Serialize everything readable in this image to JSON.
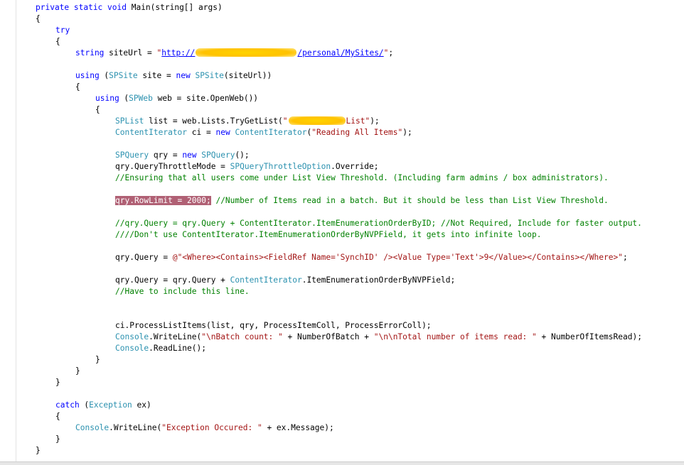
{
  "code": {
    "l1": {
      "kw1": "private static void ",
      "rest": "Main(string[] args)"
    },
    "l2": "{",
    "l3": "try",
    "l4": "{",
    "l5": {
      "kw": "string",
      "a": " siteUrl = ",
      "q": "\"",
      "url_start": "http://",
      "url_end": "/personal/MySites/",
      "end_q": "\"",
      "end": ";"
    },
    "l6": {
      "kw": "using",
      "a": " (",
      "typ": "SPSite",
      "b": " site = ",
      "kw2": "new",
      "c": " ",
      "typ2": "SPSite",
      "d": "(siteUrl))"
    },
    "l7": "{",
    "l8": {
      "kw": "using",
      "a": " (",
      "typ": "SPWeb",
      "b": " web = site.OpenWeb())"
    },
    "l9": "{",
    "l10": {
      "typ": "SPList",
      "a": " list = web.Lists.TryGetList(",
      "str1": "\"",
      "str2": "List\"",
      "end": ");"
    },
    "l11": {
      "typ": "ContentIterator",
      "a": " ci = ",
      "kw": "new",
      "b": " ",
      "typ2": "ContentIterator",
      "c": "(",
      "str": "\"Reading All Items\"",
      "d": ");"
    },
    "l12": {
      "typ": "SPQuery",
      "a": " qry = ",
      "kw": "new",
      "b": " ",
      "typ2": "SPQuery",
      "c": "();"
    },
    "l13": {
      "a": "qry.QueryThrottleMode = ",
      "typ": "SPQueryThrottleOption",
      "b": ".Override;"
    },
    "l14": "//Ensuring that all users come under List View Threshold. (Including farm admins / box administrators).",
    "l15": {
      "hl": "qry.RowLimit = 2000;",
      "cmt": " //Number of Items read in a batch. But it should be less than List View Threshold."
    },
    "l16": "//qry.Query = qry.Query + ContentIterator.ItemEnumerationOrderByID; //Not Required, Include for faster output.",
    "l17": "////Don't use ContentIterator.ItemEnumerationOrderByNVPField, it gets into infinite loop.",
    "l18": {
      "a": "qry.Query = ",
      "str": "@\"<Where><Contains><FieldRef Name='SynchID' /><Value Type='Text'>9</Value></Contains></Where>\"",
      "b": ";"
    },
    "l19": {
      "a": "qry.Query = qry.Query + ",
      "typ": "ContentIterator",
      "b": ".ItemEnumerationOrderByNVPField;"
    },
    "l20": "//Have to include this line.",
    "l21": "ci.ProcessListItems(list, qry, ProcessItemColl, ProcessErrorColl);",
    "l22": {
      "typ": "Console",
      "a": ".WriteLine(",
      "str1": "\"\\nBatch count: \"",
      "b": " + NumberOfBatch + ",
      "str2": "\"\\n\\nTotal number of items read: \"",
      "c": " + NumberOfItemsRead);"
    },
    "l23": {
      "typ": "Console",
      "a": ".ReadLine();"
    },
    "l24": "}",
    "l25": "}",
    "l26": "}",
    "l27": {
      "kw": "catch",
      "a": " (",
      "typ": "Exception",
      "b": " ex)"
    },
    "l28": "{",
    "l29": {
      "typ": "Console",
      "a": ".WriteLine(",
      "str": "\"Exception Occured: \"",
      "b": " + ex.Message);"
    },
    "l30": "}",
    "l31": "}"
  },
  "colors": {
    "keyword": "#0000ff",
    "type": "#2b91af",
    "string": "#a31515",
    "comment": "#008000",
    "highlight": "#b06074",
    "redaction": "#ffc200"
  }
}
